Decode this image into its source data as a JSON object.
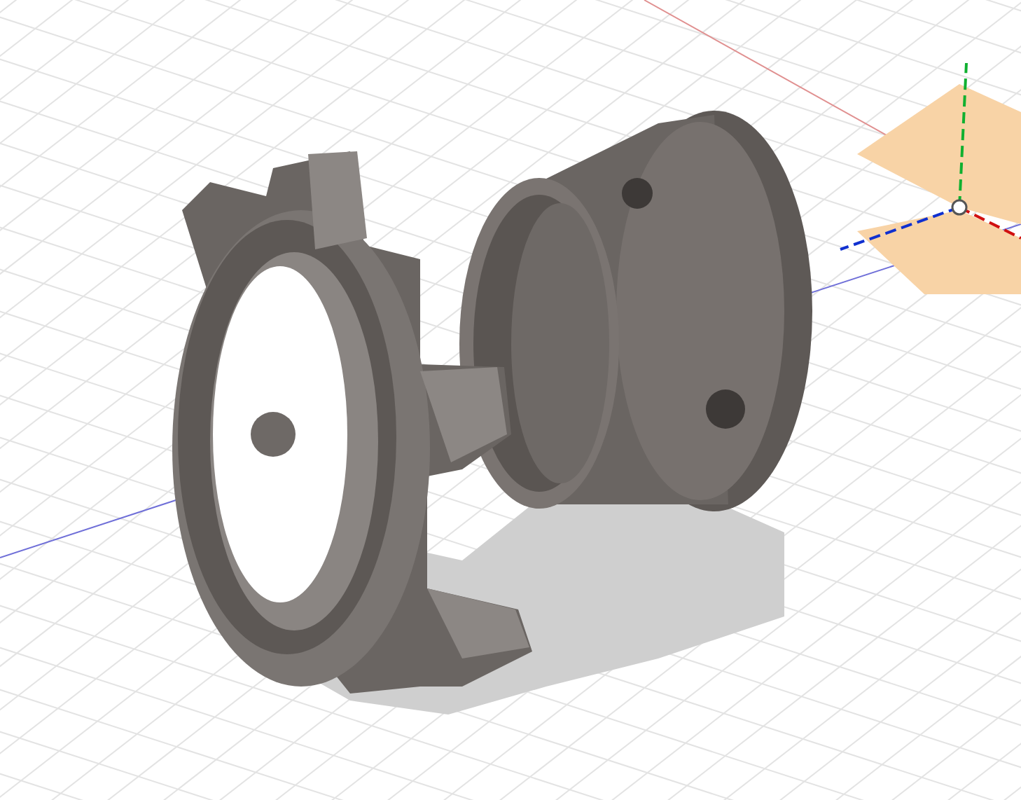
{
  "viewport": {
    "kind": "model",
    "triad": {
      "kind": "xyz"
    }
  }
}
